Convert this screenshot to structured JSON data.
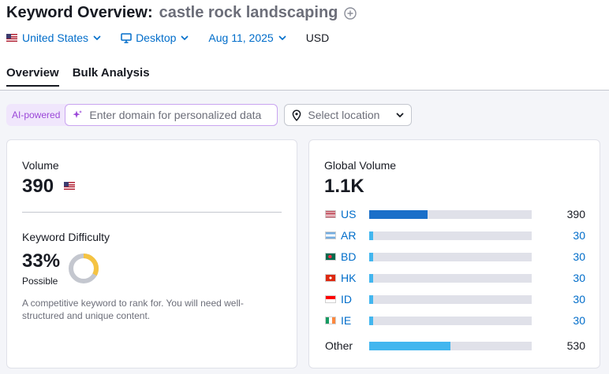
{
  "header": {
    "title_label": "Keyword Overview:",
    "keyword": "castle rock landscaping"
  },
  "filters": {
    "country": "United States",
    "device": "Desktop",
    "date": "Aug 11, 2025",
    "currency": "USD"
  },
  "tabs": [
    {
      "label": "Overview",
      "active": true
    },
    {
      "label": "Bulk Analysis",
      "active": false
    }
  ],
  "ai_bar": {
    "badge": "AI-powered",
    "domain_placeholder": "Enter domain for personalized data",
    "location_placeholder": "Select location"
  },
  "volume": {
    "label": "Volume",
    "value": "390"
  },
  "keyword_difficulty": {
    "label": "Keyword Difficulty",
    "value": "33%",
    "percent": 33,
    "level": "Possible",
    "description": "A competitive keyword to rank for. You will need well-structured and unique content.",
    "color": "#f5c342"
  },
  "global_volume": {
    "label": "Global Volume",
    "value": "1.1K",
    "rows": [
      {
        "code": "US",
        "value": "390",
        "fraction": 0.36,
        "value_color": "#171a22",
        "bar_color": "#1a6fc9"
      },
      {
        "code": "AR",
        "value": "30",
        "fraction": 0.025,
        "value_color": "#006dca",
        "bar_color": "#42b6ef"
      },
      {
        "code": "BD",
        "value": "30",
        "fraction": 0.025,
        "value_color": "#006dca",
        "bar_color": "#42b6ef"
      },
      {
        "code": "HK",
        "value": "30",
        "fraction": 0.025,
        "value_color": "#006dca",
        "bar_color": "#42b6ef"
      },
      {
        "code": "ID",
        "value": "30",
        "fraction": 0.025,
        "value_color": "#006dca",
        "bar_color": "#42b6ef"
      },
      {
        "code": "IE",
        "value": "30",
        "fraction": 0.025,
        "value_color": "#006dca",
        "bar_color": "#42b6ef"
      }
    ],
    "other": {
      "label": "Other",
      "value": "530",
      "fraction": 0.5,
      "bar_color": "#42b6ef"
    }
  }
}
